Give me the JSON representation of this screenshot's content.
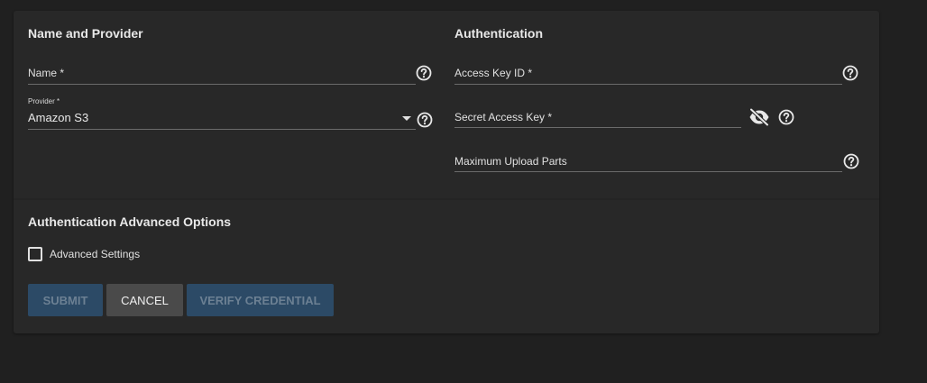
{
  "sections": {
    "name_provider": "Name and Provider",
    "authentication": "Authentication",
    "auth_advanced": "Authentication Advanced Options"
  },
  "fields": {
    "name": {
      "label": "Name *",
      "value": ""
    },
    "provider": {
      "label": "Provider *",
      "value": "Amazon S3"
    },
    "access_key_id": {
      "label": "Access Key ID *",
      "value": ""
    },
    "secret_access_key": {
      "label": "Secret Access Key *",
      "value": ""
    },
    "max_upload_parts": {
      "label": "Maximum Upload Parts",
      "value": ""
    }
  },
  "advanced_settings": {
    "label": "Advanced Settings",
    "checked": false
  },
  "buttons": {
    "submit": "SUBMIT",
    "cancel": "CANCEL",
    "verify": "VERIFY CREDENTIAL"
  },
  "icons": {
    "help": "help-circle-icon",
    "visibility": "eye-off-icon",
    "dropdown": "dropdown-caret-icon"
  },
  "colors": {
    "page_bg": "#202020",
    "card_bg": "#282828",
    "primary_disabled": "#2c4a66",
    "cancel_bg": "#4a4a4a"
  }
}
